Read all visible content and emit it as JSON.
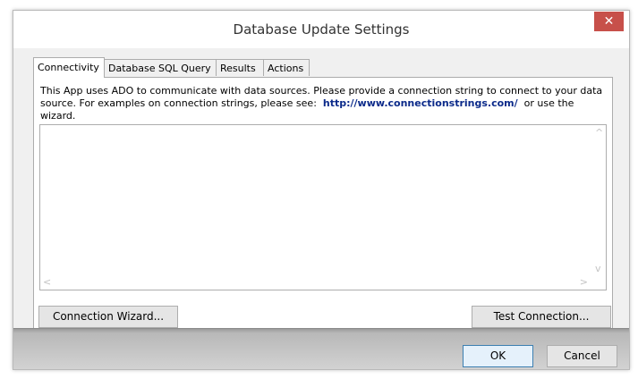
{
  "window": {
    "title": "Database Update Settings",
    "close_glyph": "✕"
  },
  "tabs": [
    {
      "label": "Connectivity",
      "active": true
    },
    {
      "label": "Database SQL Query",
      "active": false
    },
    {
      "label": "Results",
      "active": false
    },
    {
      "label": "Actions",
      "active": false
    }
  ],
  "connectivity": {
    "description_line1": "This App uses ADO to communicate with data sources.  Please provide a connection string to connect to your data",
    "description_line2_pre": "source.  For examples on connection strings, please see:",
    "link": "http://www.connectionstrings.com/",
    "description_line2_post": "or use the wizard.",
    "connection_string": "",
    "scroll_up": "^",
    "scroll_down": "v",
    "scroll_left": "<",
    "scroll_right": ">"
  },
  "buttons": {
    "wizard": "Connection Wizard...",
    "test": "Test Connection...",
    "ok": "OK",
    "cancel": "Cancel"
  },
  "colors": {
    "close": "#c7504a",
    "link": "#0b2a8a",
    "ok_border": "#3c7fb1"
  }
}
